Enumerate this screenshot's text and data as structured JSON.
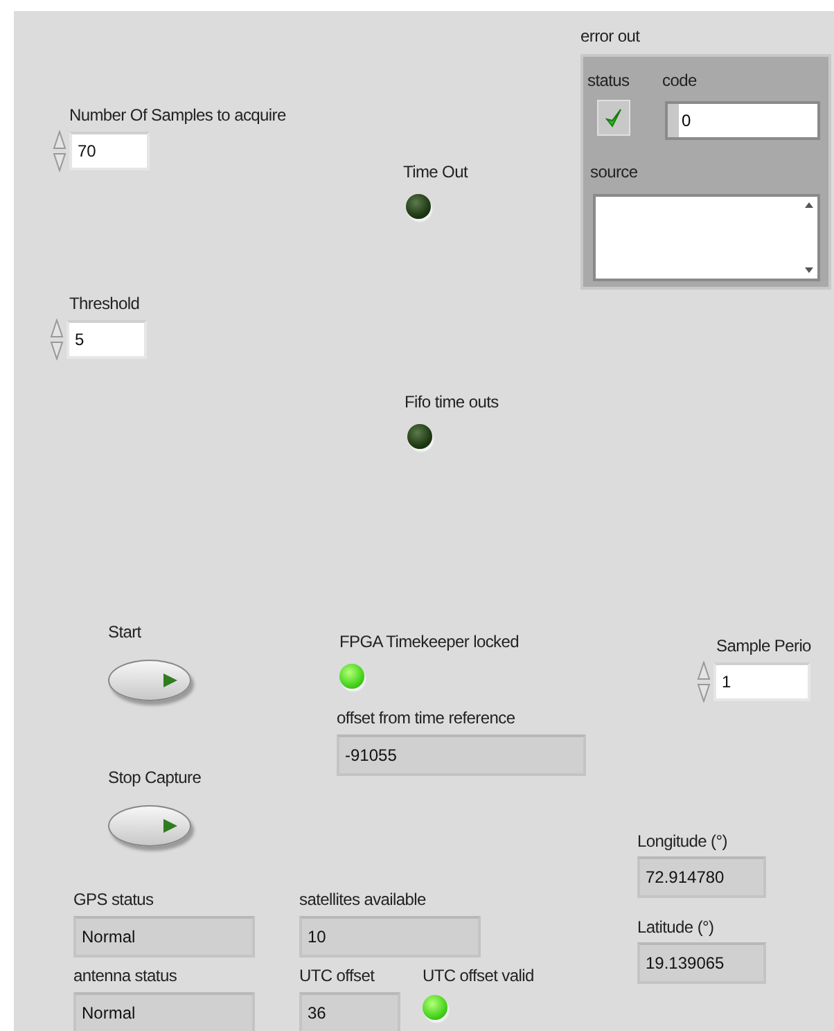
{
  "numeric_controls": [
    {
      "label": "Number Of Samples to acquire",
      "value": "70"
    },
    {
      "label": "Threshold",
      "value": "5"
    },
    {
      "label": "Sample Perio",
      "value": "1"
    }
  ],
  "leds": [
    {
      "label": "Time Out",
      "on": false
    },
    {
      "label": "Fifo time outs",
      "on": false
    },
    {
      "label": "FPGA Timekeeper locked",
      "on": true
    },
    {
      "label": "UTC offset valid",
      "on": true
    }
  ],
  "buttons": [
    {
      "label": "Start"
    },
    {
      "label": "Stop Capture"
    }
  ],
  "indicators": [
    {
      "label": "offset from time reference",
      "value": "-91055"
    },
    {
      "label": "GPS status",
      "value": "Normal"
    },
    {
      "label": "antenna status",
      "value": "Normal"
    },
    {
      "label": "satellites available",
      "value": "10"
    },
    {
      "label": "UTC offset",
      "value": "36"
    },
    {
      "label": "Longitude (°)",
      "value": "72.914780"
    },
    {
      "label": "Latitude (°)",
      "value": "19.139065"
    }
  ],
  "error_out": {
    "title": "error out",
    "status_label": "status",
    "status": true,
    "code_label": "code",
    "code": "0",
    "source_label": "source"
  }
}
